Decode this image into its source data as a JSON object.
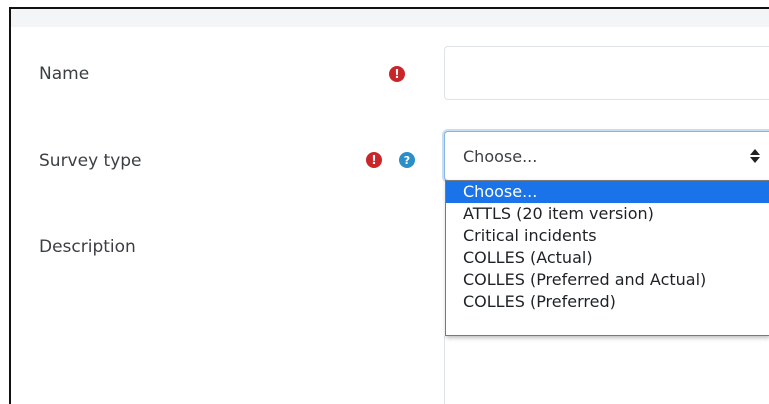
{
  "form": {
    "name_label": "Name",
    "survey_type_label": "Survey type",
    "description_label": "Description",
    "name_value": "",
    "survey_type_value": "Choose...",
    "required_icon": "exclamation-circle-icon",
    "help_icon": "question-circle-icon"
  },
  "dropdown": {
    "options": [
      "Choose...",
      "ATTLS (20 item version)",
      "Critical incidents",
      "COLLES (Actual)",
      "COLLES (Preferred and Actual)",
      "COLLES (Preferred)"
    ],
    "selected_index": 0
  },
  "colors": {
    "required": "#c9262a",
    "help": "#2a8ec7",
    "focus_border": "#87b4e3",
    "selected_option": "#1a73e8"
  }
}
